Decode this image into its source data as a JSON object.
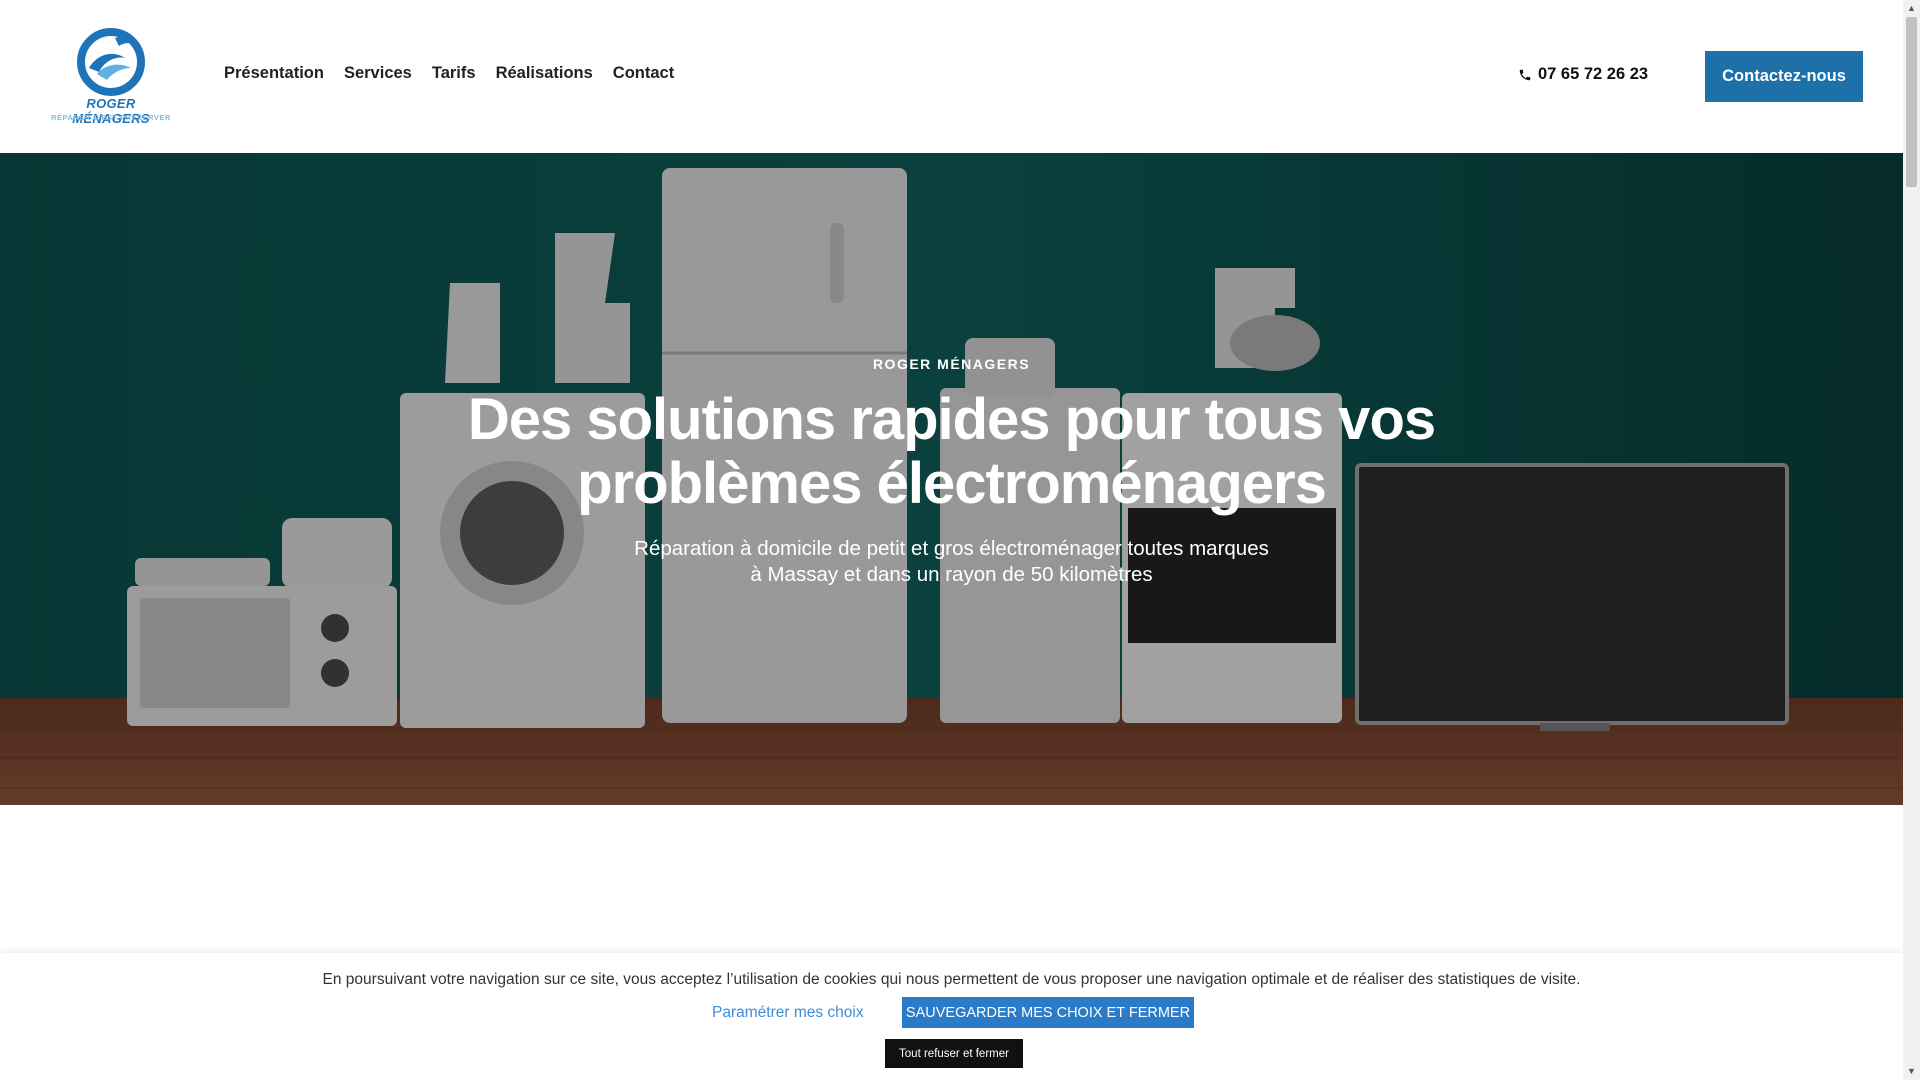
{
  "header": {
    "logo_name": "ROGER MÉNAGERS",
    "logo_tagline": "RÉPARER C'EST PRÉSERVER",
    "nav": [
      "Présentation",
      "Services",
      "Tarifs",
      "Réalisations",
      "Contact"
    ],
    "phone": "07 65 72 26 23",
    "cta_label": "Contactez-nous",
    "accent_color": "#1d70a8"
  },
  "hero": {
    "kicker": "ROGER MÉNAGERS",
    "title": "Des solutions rapides pour tous vos problèmes électroménagers",
    "subtitle_line1": "Réparation à domicile de petit et gros électroménager toutes marques",
    "subtitle_line2": "à Massay et dans un rayon de 50 kilomètres",
    "background_image": "household appliances on wooden floor against teal wall"
  },
  "cookie_banner": {
    "text": "En poursuivant votre navigation sur ce site, vous acceptez l’utilisation de cookies qui nous permettent de vous proposer une navigation optimale et de réaliser des statistiques de visite.",
    "settings_link": "Paramétrer mes choix",
    "save_button": "SAUVEGARDER MES CHOIX ET FERMER",
    "refuse_button": "Tout refuser et fermer"
  },
  "icons": {
    "phone": "phone-icon",
    "logo": "wave-logo-icon"
  }
}
